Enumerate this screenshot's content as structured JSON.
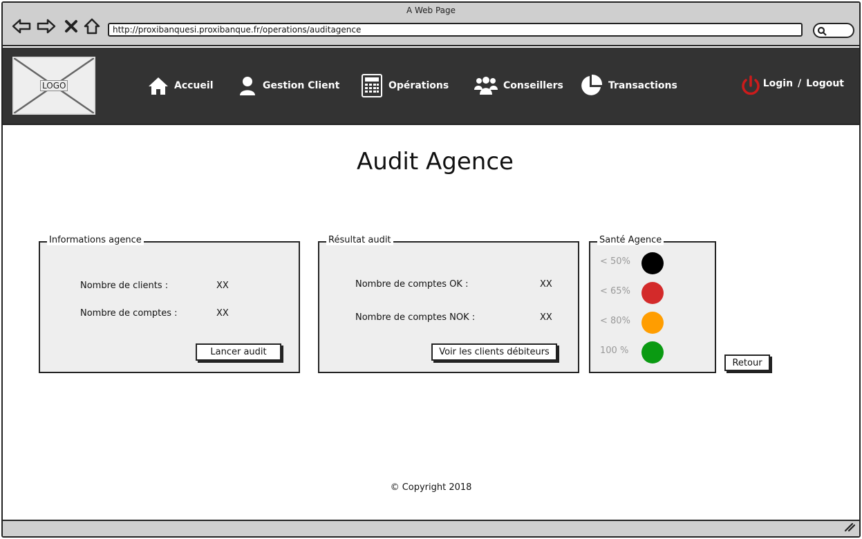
{
  "window": {
    "title": "A Web Page"
  },
  "browser": {
    "url": "http://proxibanquesi.proxibanque.fr/operations/auditagence"
  },
  "header": {
    "logo_text": "LOGO",
    "menu": [
      {
        "label": "Accueil",
        "icon": "home-icon"
      },
      {
        "label": "Gestion Client",
        "icon": "user-icon"
      },
      {
        "label": "Opérations",
        "icon": "calculator-icon"
      },
      {
        "label": "Conseillers",
        "icon": "users-icon"
      },
      {
        "label": "Transactions",
        "icon": "pie-chart-icon"
      }
    ],
    "login": "Login",
    "separator": "/",
    "logout": "Logout",
    "power_color": "#cc1b1b"
  },
  "page": {
    "title": "Audit Agence"
  },
  "info_panel": {
    "legend": "Informations agence",
    "rows": [
      {
        "label": "Nombre de clients :",
        "value": "XX"
      },
      {
        "label": "Nombre de comptes :",
        "value": "XX"
      }
    ],
    "button": "Lancer audit"
  },
  "result_panel": {
    "legend": "Résultat audit",
    "rows": [
      {
        "label": "Nombre de comptes OK :",
        "value": "XX"
      },
      {
        "label": "Nombre de comptes NOK :",
        "value": "XX"
      }
    ],
    "button": "Voir les clients débiteurs"
  },
  "health_panel": {
    "legend": "Santé Agence",
    "levels": [
      {
        "label": "< 50%",
        "color": "#000000"
      },
      {
        "label": "< 65%",
        "color": "#d32a2a"
      },
      {
        "label": "< 80%",
        "color": "#ff9d00"
      },
      {
        "label": "100 %",
        "color": "#0a9a12"
      }
    ]
  },
  "back_button": "Retour",
  "footer": {
    "copyright": "© Copyright 2018"
  }
}
